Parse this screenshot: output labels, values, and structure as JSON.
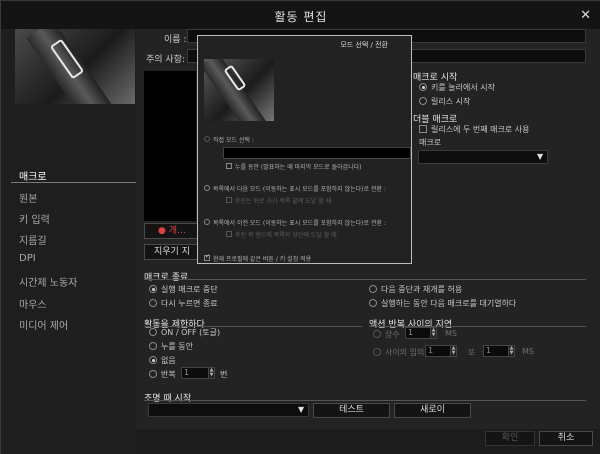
{
  "window": {
    "title": "활동 편집",
    "close": "✕"
  },
  "sidebar": {
    "items": [
      {
        "label": "매크로",
        "active": true
      },
      {
        "label": "원본"
      },
      {
        "label": "키 입력"
      },
      {
        "label": "지름길"
      },
      {
        "label": "DPI"
      },
      {
        "label": "시간제 노동자"
      },
      {
        "label": "마우스"
      },
      {
        "label": "미디어 제어"
      }
    ]
  },
  "form": {
    "name_label": "이름 :",
    "notes_label": "주의 사항:",
    "record_label": "● 개…",
    "clear_label": "지우기 지"
  },
  "macro_start": {
    "title": "매크로 시작",
    "options": [
      "키를 눌러에서 시작",
      "릴리스 시작"
    ],
    "selected": 0
  },
  "double_macro": {
    "title": "더블 매크로",
    "check_label": "릴리스에 두 번째 매크로 사용",
    "macro_label": "매크로",
    "dropdown_arrow": "▼"
  },
  "macro_end": {
    "title": "매크로 종료",
    "options_left": [
      "실행 매크로 중단",
      "다시 누르면 종료"
    ],
    "options_right": [
      "다음 중단과 재개를 허용",
      "실행하는 동안 다음 매크로를 대기열하다"
    ]
  },
  "limit": {
    "title": "활동을 제한하다",
    "options": [
      "ON / OFF (토글)",
      "누를 동안",
      "없음",
      "반복"
    ],
    "selected": 2,
    "repeat_value": "1",
    "repeat_unit": "번"
  },
  "delay": {
    "title": "액션 반복 사이의 지연",
    "constant_label": "상수",
    "constant_value": "1",
    "ms": "MS",
    "random_label": "사이의 임의",
    "random_from": "1",
    "random_to_label": "또",
    "random_to": "1",
    "ms2": "MS"
  },
  "lighting": {
    "title": "조명 때 시작",
    "dropdown_arrow": "▼",
    "test_label": "테스트",
    "refresh_label": "새로이"
  },
  "footer": {
    "ok_label": "확인",
    "cancel_label": "취소"
  },
  "popup": {
    "title": "모드 선택 / 전환",
    "opt1": "직접 모드 선택 :",
    "opt1_sub": "누를 동안 (발표하는 때 마지막 모드로 돌아갑니다)",
    "opt2": "목록에서 다음 모드 (이동하는 표시 모드를 포함하지 않는다)로 전환 :",
    "opt2_sub": "후진는 뒤로 가기 목록 끝에 도달 할 때",
    "opt3": "목록에서 이전 모드 (이동하는 표시 모드를 포함하지 않는다)로 전환 :",
    "opt3_sub": "후진 목 엔드에 목록의 상단에 도달 할 때",
    "opt4": "현재 프로필에 같은 버튼 / 키 설정 적용"
  }
}
